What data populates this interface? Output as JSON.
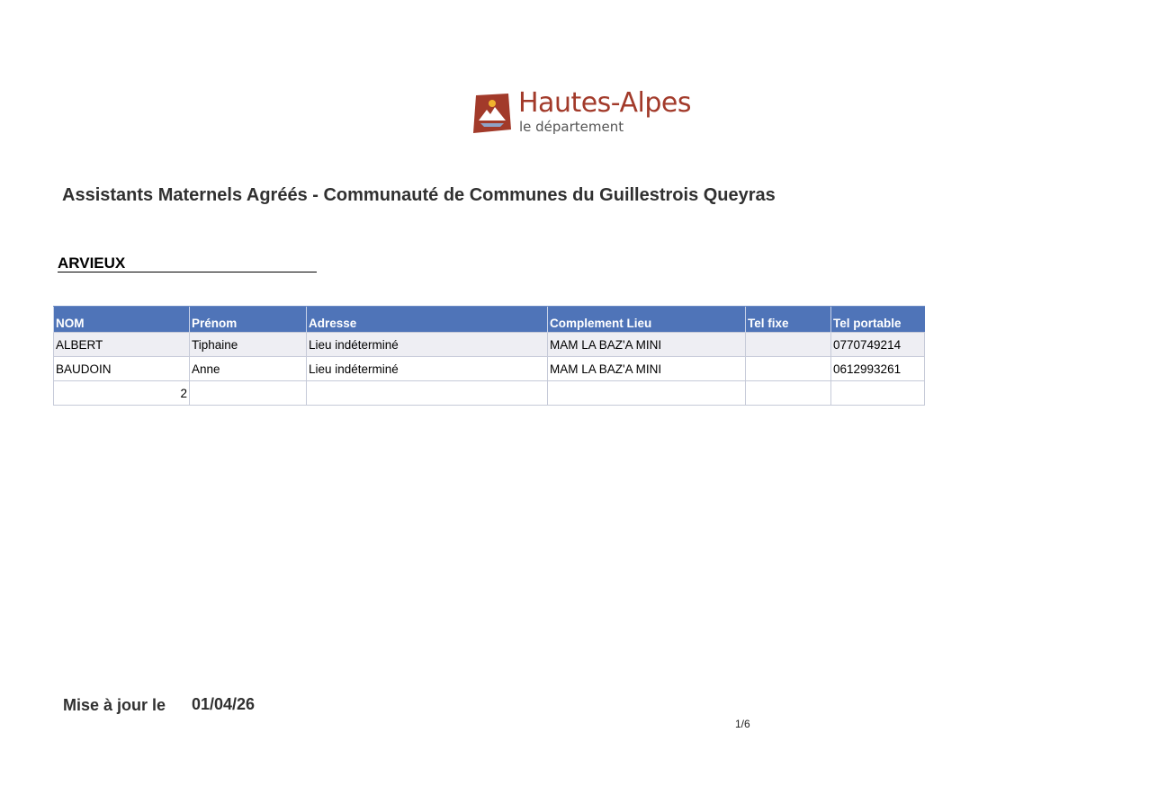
{
  "logo": {
    "title": "Hautes-Alpes",
    "subtitle": "le département",
    "colors": {
      "brand": "#a23a2a",
      "sun": "#f0b32e",
      "mountain": "#ffffff"
    }
  },
  "page_title": "Assistants Maternels Agréés - Communauté de Communes du Guillestrois Queyras",
  "commune": "ARVIEUX",
  "table": {
    "header_color": "#4f74b8",
    "columns": [
      "NOM",
      "Prénom",
      "Adresse",
      "Complement Lieu",
      "Tel fixe",
      "Tel portable"
    ],
    "rows": [
      {
        "nom": "ALBERT",
        "prenom": "Tiphaine",
        "adresse": "Lieu indéterminé",
        "complement": "MAM LA BAZ'A MINI",
        "tel_fixe": "",
        "tel_portable": "0770749214"
      },
      {
        "nom": "BAUDOIN",
        "prenom": "Anne",
        "adresse": "Lieu indéterminé",
        "complement": "MAM LA BAZ'A MINI",
        "tel_fixe": "",
        "tel_portable": "0612993261"
      }
    ],
    "count": "2"
  },
  "footer": {
    "update_label": "Mise à jour le",
    "update_date": "01/04/26",
    "page": "1/6"
  }
}
